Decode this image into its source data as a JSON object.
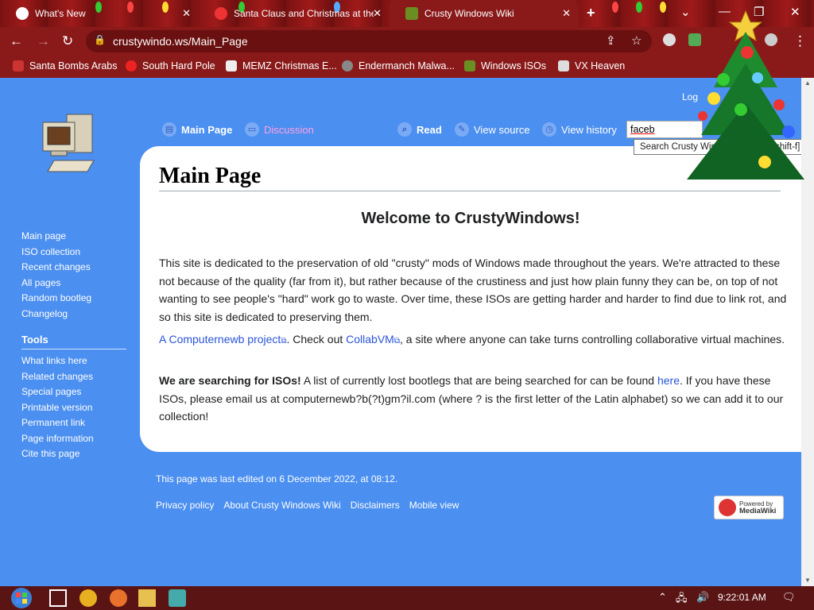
{
  "browser": {
    "tabs": [
      {
        "title": "What's New",
        "active": false
      },
      {
        "title": "Santa Claus and Christmas at the",
        "active": false
      },
      {
        "title": "Crusty Windows Wiki",
        "active": true
      }
    ],
    "new_tab_label": "+",
    "url": "crustywindo.ws/Main_Page",
    "bookmarks": [
      {
        "label": "Santa Bombs Arabs"
      },
      {
        "label": "South Hard Pole"
      },
      {
        "label": "MEMZ Christmas E..."
      },
      {
        "label": "Endermanch Malwa..."
      },
      {
        "label": "Windows ISOs"
      },
      {
        "label": "VX Heaven"
      }
    ],
    "colors": {
      "chrome_bg": "#8a1a1a",
      "page_bg": "#4b8ff0"
    }
  },
  "wiki": {
    "login_text": "Log",
    "page_tabs": {
      "main_page": "Main Page",
      "discussion": "Discussion",
      "read": "Read",
      "view_source": "View source",
      "view_history": "View history"
    },
    "search": {
      "value": "faceb",
      "tooltip": "Search Crusty Windows Wiki [alt-shift-f]"
    },
    "sidebar": {
      "navigation": [
        "Main page",
        "ISO collection",
        "Recent changes",
        "All pages",
        "Random bootleg",
        "Changelog"
      ],
      "tools_heading": "Tools",
      "tools": [
        "What links here",
        "Related changes",
        "Special pages",
        "Printable version",
        "Permanent link",
        "Page information",
        "Cite this page"
      ]
    },
    "content": {
      "title": "Main Page",
      "welcome": "Welcome to CrustyWindows!",
      "p1": "This site is dedicated to the preservation of old \"crusty\" mods of Windows made throughout the years. We're attracted to these not because of the quality (far from it), but rather because of the crustiness and just how plain funny they can be, on top of not wanting to see people's \"hard\" work go to waste. Over time, these ISOs are getting harder and harder to find due to link rot, and so this site is dedicated to preserving them.",
      "p2_link1": "A Computernewb project",
      "p2_mid": ". Check out ",
      "p2_link2": "CollabVM",
      "p2_end": ", a site where anyone can take turns controlling collaborative virtual machines.",
      "p3_bold": "We are searching for ISOs!",
      "p3_a": " A list of currently lost bootlegs that are being searched for can be found ",
      "p3_link": "here",
      "p3_b": ". If you have these ISOs, please email us at computernewb?b(?t)gm?il.com (where ? is the first letter of the Latin alphabet) so we can add it to our collection!"
    },
    "footer": {
      "last_edited": "This page was last edited on 6 December 2022, at 08:12.",
      "links": [
        "Privacy policy",
        "About Crusty Windows Wiki",
        "Disclaimers",
        "Mobile view"
      ],
      "badge_line1": "Powered by",
      "badge_line2": "MediaWiki"
    }
  },
  "taskbar": {
    "clock": "9:22:01 AM"
  }
}
